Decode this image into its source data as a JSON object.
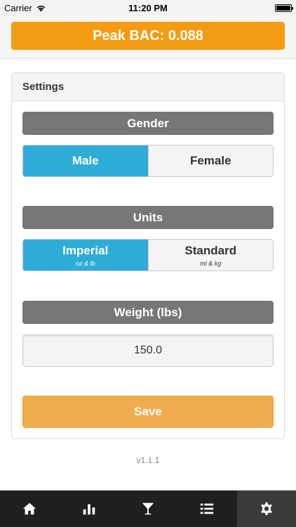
{
  "status_bar": {
    "carrier": "Carrier",
    "time": "11:20 PM"
  },
  "peak": {
    "label": "Peak BAC: 0.088"
  },
  "settings": {
    "title": "Settings",
    "gender": {
      "label": "Gender",
      "options": [
        "Male",
        "Female"
      ],
      "selected": "Male"
    },
    "units": {
      "label": "Units",
      "options": [
        {
          "label": "Imperial",
          "sub": "oz & lb"
        },
        {
          "label": "Standard",
          "sub": "ml & kg"
        }
      ],
      "selected": "Imperial"
    },
    "weight": {
      "label": "Weight (lbs)",
      "value": "150.0"
    },
    "save_label": "Save"
  },
  "version": "v1.1.1",
  "tabs": [
    {
      "icon": "home-icon"
    },
    {
      "icon": "bar-chart-icon"
    },
    {
      "icon": "cocktail-glass-icon"
    },
    {
      "icon": "list-icon"
    },
    {
      "icon": "gear-icon",
      "active": true
    }
  ],
  "colors": {
    "accent_orange": "#f39c12",
    "save_orange": "#f0ad4e",
    "active_blue": "#2eacd8",
    "label_gray": "#777777",
    "tab_bar": "#1f1f1f"
  }
}
